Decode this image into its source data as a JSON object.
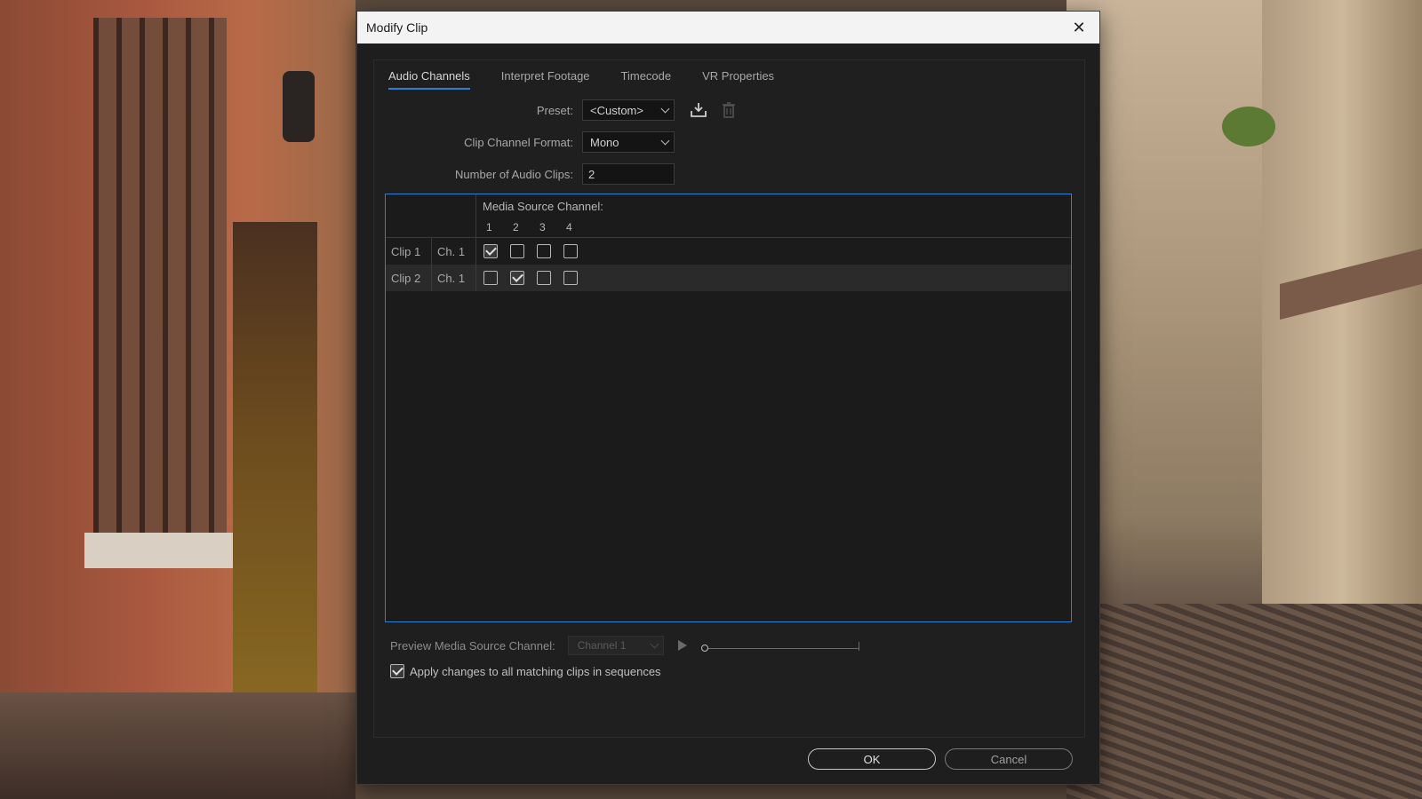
{
  "dialog": {
    "title": "Modify Clip",
    "close_glyph": "✕"
  },
  "tabs": [
    {
      "label": "Audio Channels",
      "active": true
    },
    {
      "label": "Interpret Footage",
      "active": false
    },
    {
      "label": "Timecode",
      "active": false
    },
    {
      "label": "VR Properties",
      "active": false
    }
  ],
  "form": {
    "preset_label": "Preset:",
    "preset_value": "<Custom>",
    "format_label": "Clip Channel Format:",
    "format_value": "Mono",
    "num_clips_label": "Number of Audio Clips:",
    "num_clips_value": "2",
    "save_preset_icon": "download-icon",
    "delete_preset_icon": "trash-icon"
  },
  "grid": {
    "header": "Media Source Channel:",
    "channels": [
      "1",
      "2",
      "3",
      "4"
    ],
    "rows": [
      {
        "clip": "Clip 1",
        "channel": "Ch. 1",
        "checked": [
          true,
          false,
          false,
          false
        ]
      },
      {
        "clip": "Clip 2",
        "channel": "Ch. 1",
        "checked": [
          false,
          true,
          false,
          false
        ]
      }
    ]
  },
  "preview": {
    "label": "Preview Media Source Channel:",
    "select_value": "Channel 1",
    "position": 0
  },
  "apply": {
    "label": "Apply changes to all matching clips in sequences",
    "checked": true
  },
  "buttons": {
    "ok": "OK",
    "cancel": "Cancel"
  },
  "colors": {
    "accent": "#2e7fd6",
    "dialog_bg": "#1e1e1e",
    "titlebar_bg": "#f3f3f3"
  }
}
